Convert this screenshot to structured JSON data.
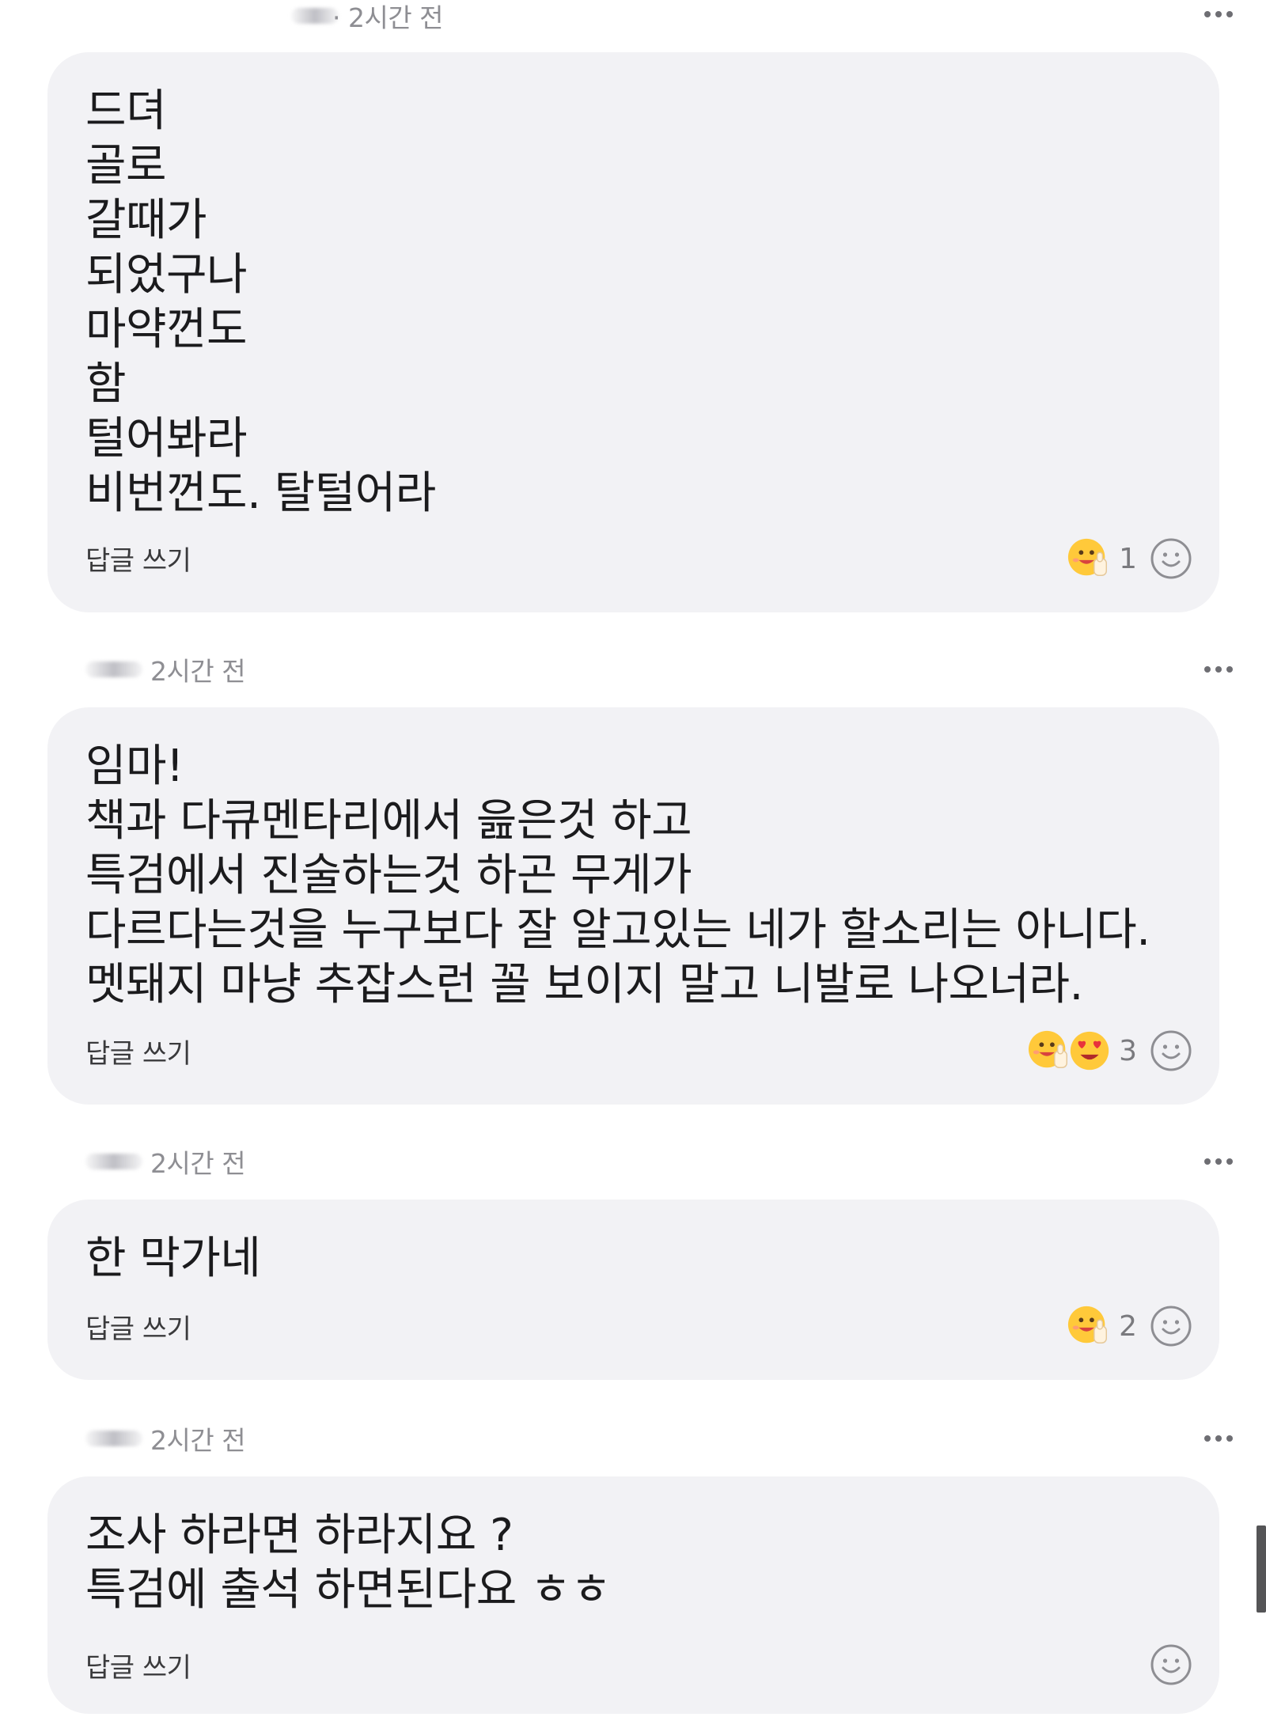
{
  "comments": [
    {
      "time": "· 2시간 전",
      "text": "드뎌\n골로\n갈때가\n되었구나\n마약껀도\n함\n털어봐라\n비번껀도. 탈털어라",
      "reply_label": "답글 쓰기",
      "reactions": [
        "grinning-thumbs-up"
      ],
      "reaction_count": "1"
    },
    {
      "time": "2시간 전",
      "text": "임마!\n책과 다큐멘타리에서 읊은것 하고\n특검에서 진술하는것 하곤 무게가\n다르다는것을 누구보다 잘 알고있는 네가 할소리는 아니다.\n멧돼지 마냥 추잡스런 꼴 보이지 말고 니발로 나오너라.",
      "reply_label": "답글 쓰기",
      "reactions": [
        "grinning-thumbs-up",
        "heart-eyes"
      ],
      "reaction_count": "3"
    },
    {
      "time": "2시간 전",
      "text": "한 막가네",
      "reply_label": "답글 쓰기",
      "reactions": [
        "grinning-thumbs-up"
      ],
      "reaction_count": "2"
    },
    {
      "time": "2시간 전",
      "text": "조사 하라면 하라지요 ?\n특검에 출석 하면된다요 ㅎㅎ",
      "reply_label": "답글 쓰기",
      "reactions": [],
      "reaction_count": ""
    }
  ],
  "icons": {
    "more": "more-horizontal-icon",
    "add_reaction": "smiley-outline-icon"
  },
  "colors": {
    "bubble": "#f2f2f5",
    "muted_text": "#8e8e93",
    "body_text": "#1b1b1d"
  }
}
